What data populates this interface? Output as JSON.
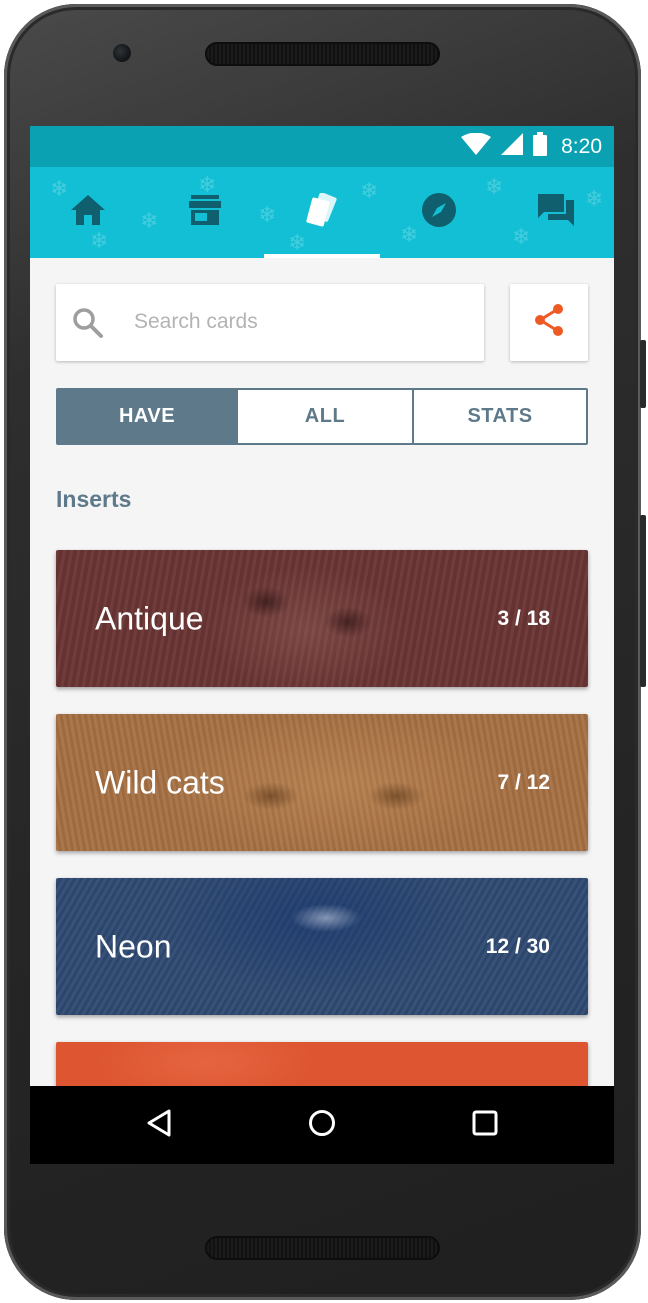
{
  "status_bar": {
    "time": "8:20",
    "icons": [
      "wifi-icon",
      "signal-icon",
      "battery-icon"
    ]
  },
  "tabs": [
    {
      "icon": "home-icon",
      "active": false
    },
    {
      "icon": "store-icon",
      "active": false
    },
    {
      "icon": "cards-icon",
      "active": true
    },
    {
      "icon": "compass-icon",
      "active": false
    },
    {
      "icon": "chat-icon",
      "active": false
    }
  ],
  "search": {
    "placeholder": "Search cards",
    "value": ""
  },
  "share": {
    "icon": "share-icon"
  },
  "segments": [
    {
      "label": "HAVE",
      "active": true
    },
    {
      "label": "ALL",
      "active": false
    },
    {
      "label": "STATS",
      "active": false
    }
  ],
  "section_title": "Inserts",
  "cards": [
    {
      "name": "Antique",
      "count": "3 / 18",
      "color": "#6a3534"
    },
    {
      "name": "Wild cats",
      "count": "7 / 12",
      "color": "#a56f42"
    },
    {
      "name": "Neon",
      "count": "12 / 30",
      "color": "#2f4a72"
    },
    {
      "name": "",
      "count": "",
      "color": "#dd5531"
    }
  ],
  "colors": {
    "status_bar": "#0aa2b2",
    "tab_bar": "#12bfd4",
    "accent": "#ef5a24",
    "segment": "#5e7a8a"
  },
  "nav": [
    "back-icon",
    "home-circle-icon",
    "recents-icon"
  ]
}
